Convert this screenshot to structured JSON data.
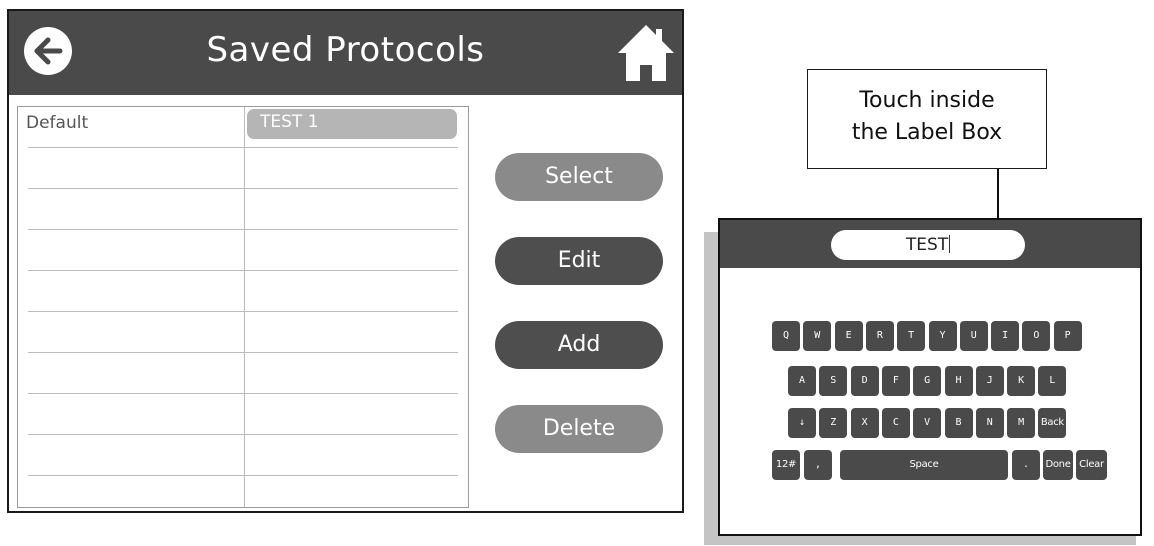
{
  "screen": {
    "title": "Saved Protocols",
    "back_icon": "back-arrow-icon",
    "home_icon": "home-icon",
    "protocols": [
      {
        "left": "Default",
        "right": "TEST 1"
      },
      {
        "left": "",
        "right": ""
      },
      {
        "left": "",
        "right": ""
      },
      {
        "left": "",
        "right": ""
      },
      {
        "left": "",
        "right": ""
      },
      {
        "left": "",
        "right": ""
      },
      {
        "left": "",
        "right": ""
      },
      {
        "left": "",
        "right": ""
      },
      {
        "left": "",
        "right": ""
      },
      {
        "left": "",
        "right": ""
      }
    ],
    "buttons": {
      "select": "Select",
      "edit": "Edit",
      "add": "Add",
      "delete": "Delete"
    }
  },
  "callout": {
    "line1": "Touch inside",
    "line2": "the Label Box"
  },
  "keyboard": {
    "label_value": "TEST",
    "row1": [
      "Q",
      "W",
      "E",
      "R",
      "T",
      "Y",
      "U",
      "I",
      "O",
      "P"
    ],
    "row2": [
      "A",
      "S",
      "D",
      "F",
      "G",
      "H",
      "J",
      "K",
      "L"
    ],
    "row3": [
      "↓",
      "Z",
      "X",
      "C",
      "V",
      "B",
      "N",
      "M",
      "Back"
    ],
    "row4": [
      "12#",
      ",",
      "Space",
      ".",
      "Done",
      "Clear"
    ]
  },
  "colors": {
    "header": "#4a4a4a",
    "selected_row": "#b5b5b5",
    "button_light": "#8a8a8a",
    "button_dark": "#4e4e4e"
  }
}
